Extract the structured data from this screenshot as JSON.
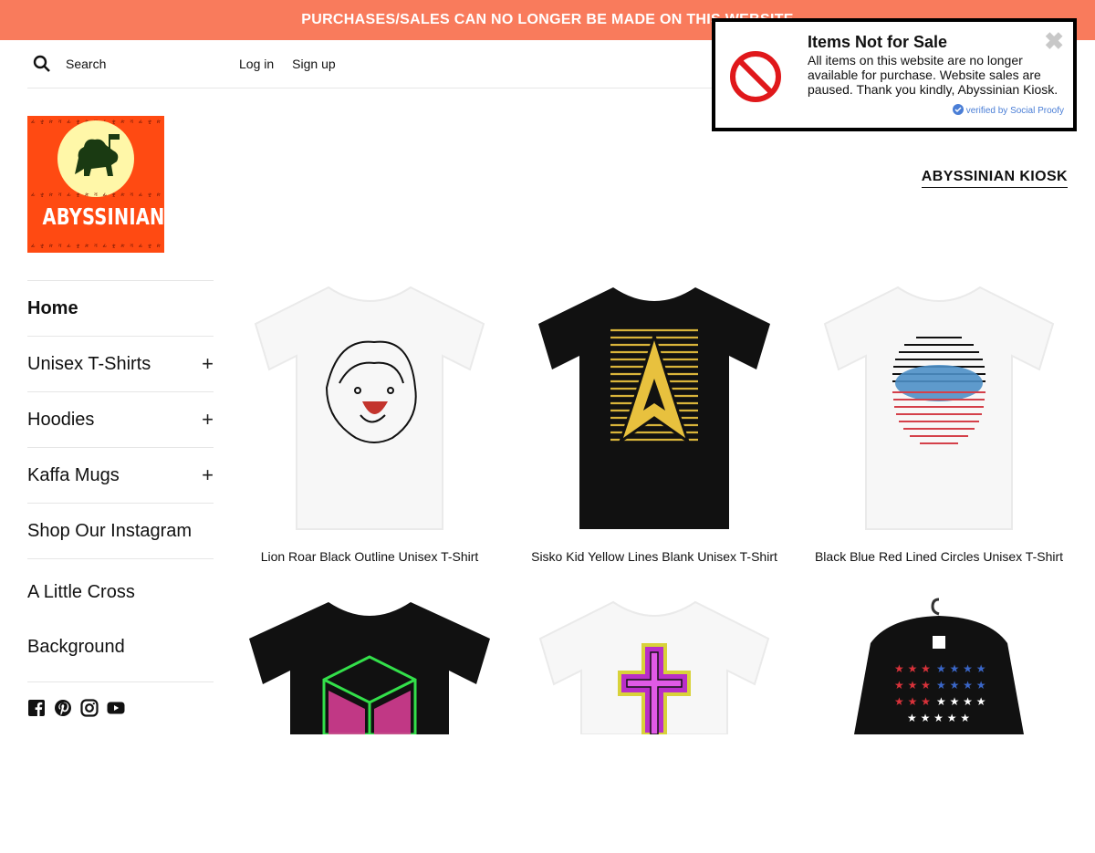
{
  "banner": {
    "text": "PURCHASES/SALES CAN NO LONGER BE MADE ON THIS WEBSITE"
  },
  "topbar": {
    "search_placeholder": "Search",
    "login": "Log in",
    "signup": "Sign up"
  },
  "logo": {
    "text": "ABYSSINIAN"
  },
  "brand_link": "ABYSSINIAN KIOSK",
  "sidebar": {
    "items": [
      {
        "label": "Home"
      },
      {
        "label": "Unisex T-Shirts",
        "expand": "+"
      },
      {
        "label": "Hoodies",
        "expand": "+"
      },
      {
        "label": "Kaffa Mugs",
        "expand": "+"
      },
      {
        "label": "Shop Our Instagram"
      },
      {
        "label_line1": "A Little Cross",
        "label_line2": "Background"
      }
    ],
    "social": [
      "facebook-icon",
      "pinterest-icon",
      "instagram-icon",
      "youtube-icon"
    ]
  },
  "products": [
    {
      "title": "Lion Roar Black Outline Unisex T-Shirt",
      "shirt_color": "#f6f6f6"
    },
    {
      "title": "Sisko Kid Yellow Lines Blank Unisex T-Shirt",
      "shirt_color": "#111111"
    },
    {
      "title": "Black Blue Red Lined Circles Unisex T-Shirt",
      "shirt_color": "#f6f6f6"
    },
    {
      "title": "",
      "shirt_color": "#111111"
    },
    {
      "title": "",
      "shirt_color": "#f6f6f6"
    },
    {
      "title": "",
      "shirt_color": "#111111"
    }
  ],
  "popup": {
    "title": "Items Not for Sale",
    "message": "All items on this website are no longer available for purchase. Website sales are paused. Thank you kindly, Abyssinian Kiosk.",
    "verified": "verified by Social Proofy",
    "close": "✖"
  },
  "colors": {
    "banner": "#f97b5c",
    "logo_bg": "#ff4a12",
    "popup_border": "#000000",
    "verify": "#4a7ed6"
  }
}
